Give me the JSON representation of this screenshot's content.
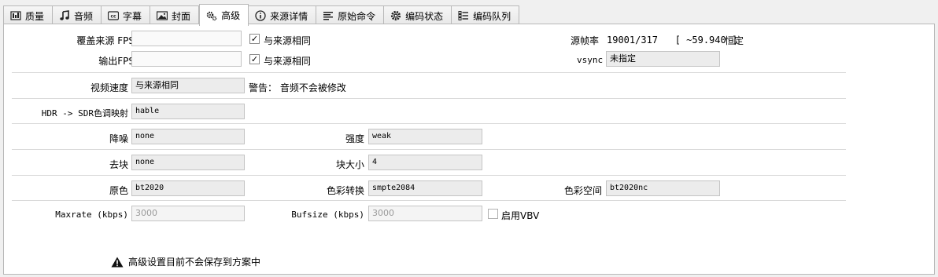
{
  "tabs": [
    {
      "label": "质量",
      "icon": "quality-icon",
      "active": false
    },
    {
      "label": "音频",
      "icon": "music-icon",
      "active": false
    },
    {
      "label": "字幕",
      "icon": "subtitle-icon",
      "active": false
    },
    {
      "label": "封面",
      "icon": "image-icon",
      "active": false
    },
    {
      "label": "高级",
      "icon": "gears-icon",
      "active": true
    },
    {
      "label": "来源详情",
      "icon": "info-icon",
      "active": false
    },
    {
      "label": "原始命令",
      "icon": "lines-icon",
      "active": false
    },
    {
      "label": "编码状态",
      "icon": "gear-icon",
      "active": false
    },
    {
      "label": "编码队列",
      "icon": "list-icon",
      "active": false
    }
  ],
  "fps": {
    "override_label": "覆盖来源 FPS",
    "override_value": "",
    "override_same_label": "与来源相同",
    "override_same_checked": true,
    "output_label": "输出FPS",
    "output_value": "",
    "output_same_label": "与来源相同",
    "output_same_checked": true,
    "source_rate_label": "源帧率",
    "source_rate_value": "19001/317   [ ~59.940 ]",
    "source_rate_mode": "恒定",
    "vsync_label": "vsync",
    "vsync_value": "未指定"
  },
  "speed": {
    "label": "视频速度",
    "value": "与来源相同",
    "warning": "警告： 音频不会被修改"
  },
  "hdr": {
    "label": "HDR -> SDR色调映射",
    "value": "hable"
  },
  "denoise": {
    "label": "降噪",
    "value": "none",
    "strength_label": "强度",
    "strength_value": "weak"
  },
  "deblock": {
    "label": "去块",
    "value": "none",
    "block_size_label": "块大小",
    "block_size_value": "4"
  },
  "color": {
    "primaries_label": "原色",
    "primaries_value": "bt2020",
    "transfer_label": "色彩转换",
    "transfer_value": "smpte2084",
    "space_label": "色彩空间",
    "space_value": "bt2020nc"
  },
  "rate": {
    "maxrate_label": "Maxrate (kbps)",
    "maxrate_placeholder": "3000",
    "bufsize_label": "Bufsize (kbps)",
    "bufsize_placeholder": "3000",
    "vbv_label": "启用VBV",
    "vbv_checked": false
  },
  "footer_warning": "高级设置目前不会保存到方案中",
  "colors": {
    "accent": "#000000",
    "border": "#b8b8b8",
    "field_bg": "#ececec"
  }
}
